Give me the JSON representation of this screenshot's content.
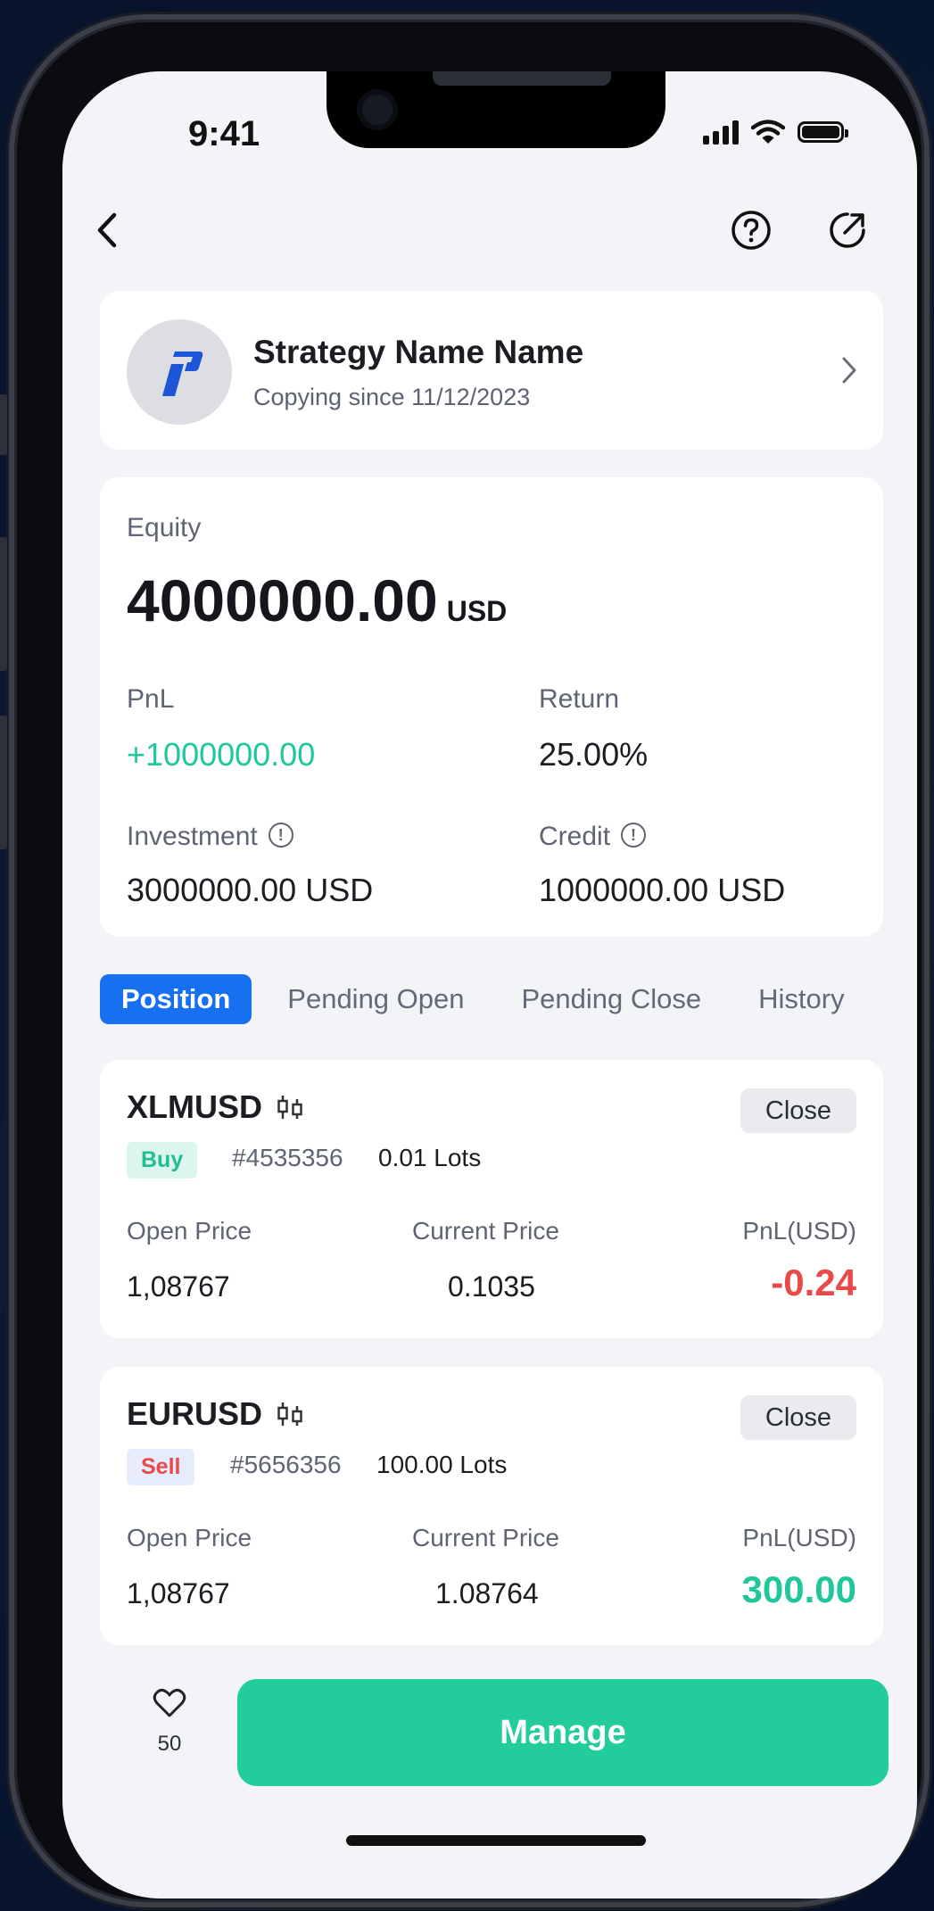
{
  "status_bar": {
    "time": "9:41"
  },
  "strategy": {
    "name": "Strategy Name Name",
    "copying_since": "Copying since 11/12/2023"
  },
  "account": {
    "equity_label": "Equity",
    "equity_value": "4000000.00",
    "equity_unit": "USD",
    "pnl_label": "PnL",
    "pnl_value": "+1000000.00",
    "return_label": "Return",
    "return_value": "25.00%",
    "investment_label": "Investment",
    "investment_value": "3000000.00 USD",
    "credit_label": "Credit",
    "credit_value": "1000000.00 USD"
  },
  "tabs": [
    {
      "label": "Position",
      "active": true
    },
    {
      "label": "Pending Open"
    },
    {
      "label": "Pending Close"
    },
    {
      "label": "History"
    }
  ],
  "positions": [
    {
      "symbol": "XLMUSD",
      "side": "Buy",
      "ticket": "#4535356",
      "lots": "0.01 Lots",
      "close_label": "Close",
      "open_price_label": "Open Price",
      "open_price": "1,08767",
      "current_price_label": "Current Price",
      "current_price": "0.1035",
      "pnl_label": "PnL(USD)",
      "pnl": "-0.24"
    },
    {
      "symbol": "EURUSD",
      "side": "Sell",
      "ticket": "#5656356",
      "lots": "100.00 Lots",
      "close_label": "Close",
      "open_price_label": "Open Price",
      "open_price": "1,08767",
      "current_price_label": "Current Price",
      "current_price": "1.08764",
      "pnl_label": "PnL(USD)",
      "pnl": "300.00"
    }
  ],
  "footer": {
    "favorite_count": "50",
    "manage_label": "Manage"
  },
  "icons": {
    "back": "chevron-left-icon",
    "help": "question-circle-icon",
    "share": "share-icon",
    "strategy_chevron": "chevron-right-icon",
    "info": "info-icon",
    "chart": "candlestick-icon",
    "favorite": "heart-icon"
  },
  "colors": {
    "accent_blue": "#1670f0",
    "positive": "#1fc79a",
    "negative": "#e84a4a",
    "manage": "#22cc9b"
  }
}
